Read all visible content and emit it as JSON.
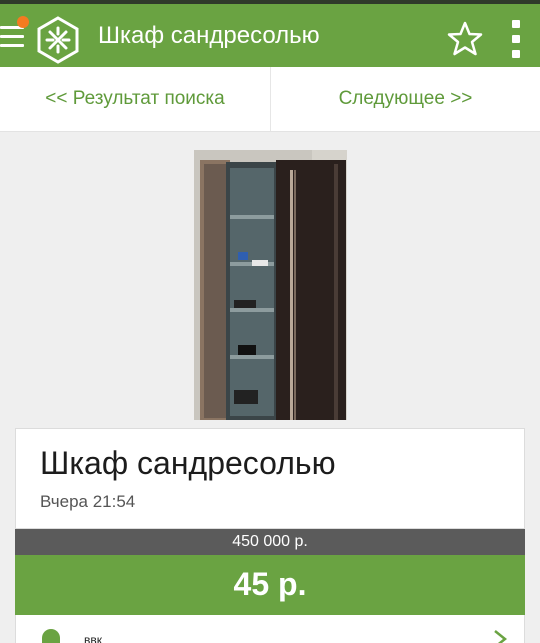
{
  "header": {
    "title": "Шкаф сандресолью",
    "icons": [
      "menu-icon",
      "logo-icon",
      "star-icon",
      "more-vert-icon"
    ],
    "brand_color": "#6aa342",
    "notification_color": "#f47b20"
  },
  "nav": {
    "prev_label": "<< Результат поиска",
    "next_label": "Следующее >>"
  },
  "listing": {
    "title": "Шкаф сандресолью",
    "posted": "Вчера 21:54",
    "old_price": "450 000 р.",
    "price": "45 р."
  },
  "seller": {
    "name": "ввк",
    "icons": [
      "person-icon",
      "chevron-right-icon"
    ]
  }
}
